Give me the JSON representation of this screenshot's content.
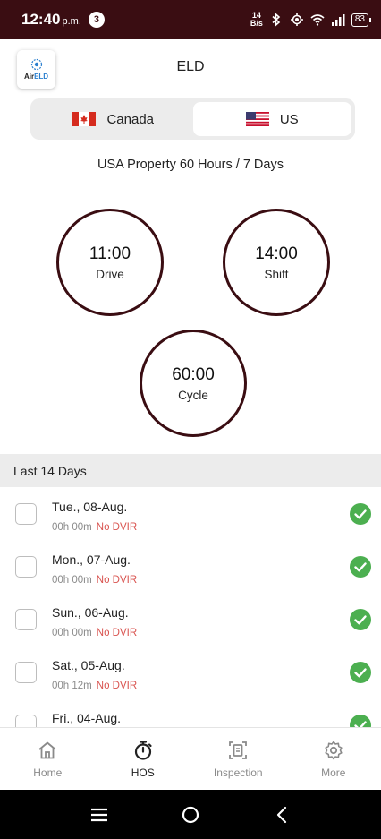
{
  "status_bar": {
    "time": "12:40",
    "time_suffix": "p.m.",
    "notification_count": "3",
    "net_speed_value": "14",
    "net_speed_unit": "B/s",
    "battery": "83"
  },
  "header": {
    "logo_text_a": "Air",
    "logo_text_b": "ELD",
    "title": "ELD"
  },
  "region_selector": {
    "options": [
      {
        "label": "Canada",
        "selected": false
      },
      {
        "label": "US",
        "selected": true
      }
    ]
  },
  "ruleset": "USA Property 60 Hours / 7 Days",
  "timers": [
    {
      "value": "11:00",
      "label": "Drive"
    },
    {
      "value": "14:00",
      "label": "Shift"
    },
    {
      "value": "60:00",
      "label": "Cycle"
    }
  ],
  "days_section": {
    "title": "Last 14 Days",
    "days": [
      {
        "date": "Tue., 08-Aug.",
        "duration": "00h 00m",
        "dvir": "No DVIR"
      },
      {
        "date": "Mon., 07-Aug.",
        "duration": "00h 00m",
        "dvir": "No DVIR"
      },
      {
        "date": "Sun., 06-Aug.",
        "duration": "00h 00m",
        "dvir": "No DVIR"
      },
      {
        "date": "Sat., 05-Aug.",
        "duration": "00h 12m",
        "dvir": "No DVIR"
      },
      {
        "date": "Fri., 04-Aug.",
        "duration": "",
        "dvir": ""
      }
    ]
  },
  "bottom_nav": {
    "items": [
      {
        "label": "Home",
        "icon": "home-icon"
      },
      {
        "label": "HOS",
        "icon": "stopwatch-icon",
        "active": true
      },
      {
        "label": "Inspection",
        "icon": "inspection-icon"
      },
      {
        "label": "More",
        "icon": "gear-icon"
      }
    ]
  },
  "colors": {
    "brand": "#3a0d12",
    "success": "#4caf50",
    "warning_text": "#d9534f"
  }
}
